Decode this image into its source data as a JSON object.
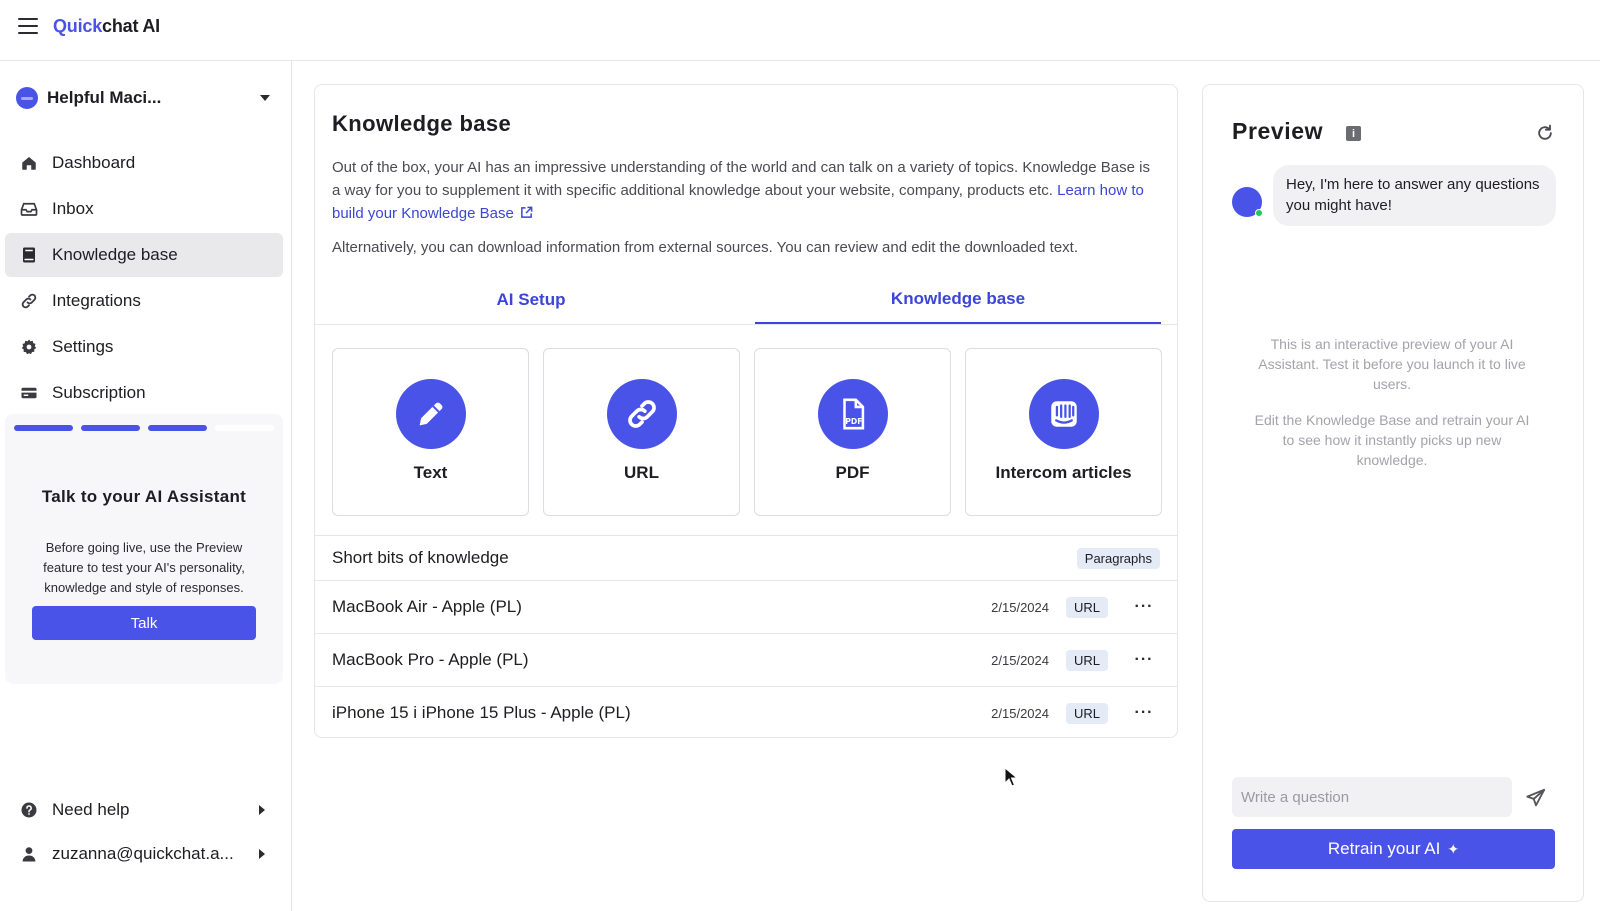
{
  "app": {
    "logo_part1": "Quick",
    "logo_part2": "chat AI"
  },
  "sidebar": {
    "bot_name": "Helpful Maci...",
    "nav": [
      {
        "label": "Dashboard",
        "icon": "home-icon"
      },
      {
        "label": "Inbox",
        "icon": "inbox-icon"
      },
      {
        "label": "Knowledge base",
        "icon": "book-icon",
        "active": true
      },
      {
        "label": "Integrations",
        "icon": "link-icon"
      },
      {
        "label": "Settings",
        "icon": "gear-icon"
      },
      {
        "label": "Subscription",
        "icon": "card-icon"
      }
    ],
    "promo": {
      "steps_done": 3,
      "steps_total": 4,
      "title": "Talk to your AI Assistant",
      "text": "Before going live, use the Preview feature to test your AI's personality, knowledge and style of responses.",
      "button": "Talk"
    },
    "need_help": "Need help",
    "user_email": "zuzanna@quickchat.a..."
  },
  "main": {
    "title": "Knowledge base",
    "desc_text": "Out of the box, your AI has an impressive understanding of the world and can talk on a variety of topics. Knowledge Base is a way for you to supplement it with specific additional knowledge about your website, company, products etc.",
    "desc_link": "Learn how to build your Knowledge Base",
    "alt_text": "Alternatively, you can download information from external sources. You can review and edit the downloaded text.",
    "tabs": [
      {
        "label": "AI Setup"
      },
      {
        "label": "Knowledge base",
        "active": true
      }
    ],
    "sources": [
      {
        "label": "Text",
        "icon": "pencil-icon"
      },
      {
        "label": "URL",
        "icon": "link-icon"
      },
      {
        "label": "PDF",
        "icon": "pdf-icon"
      },
      {
        "label": "Intercom articles",
        "icon": "intercom-icon"
      }
    ],
    "short_bits": {
      "label": "Short bits of knowledge",
      "badge": "Paragraphs"
    },
    "items": [
      {
        "name": "MacBook Air - Apple (PL)",
        "date": "2/15/2024",
        "type": "URL"
      },
      {
        "name": "MacBook Pro - Apple (PL)",
        "date": "2/15/2024",
        "type": "URL"
      },
      {
        "name": "iPhone 15 i iPhone 15 Plus - Apple (PL)",
        "date": "2/15/2024",
        "type": "URL"
      }
    ],
    "more_label": "···"
  },
  "preview": {
    "title": "Preview",
    "info": "i",
    "greeting": "Hey, I'm here to answer any questions you might have!",
    "hint1": "This is an interactive preview of your AI Assistant. Test it before you launch it to live users.",
    "hint2": "Edit the Knowledge Base and retrain your AI to see how it instantly picks up new knowledge.",
    "input_placeholder": "Write a question",
    "retrain_button": "Retrain your AI"
  },
  "colors": {
    "accent": "#4a53e8",
    "link": "#3b45d6",
    "badge_bg": "#e4ebf7",
    "online": "#22c55e"
  }
}
